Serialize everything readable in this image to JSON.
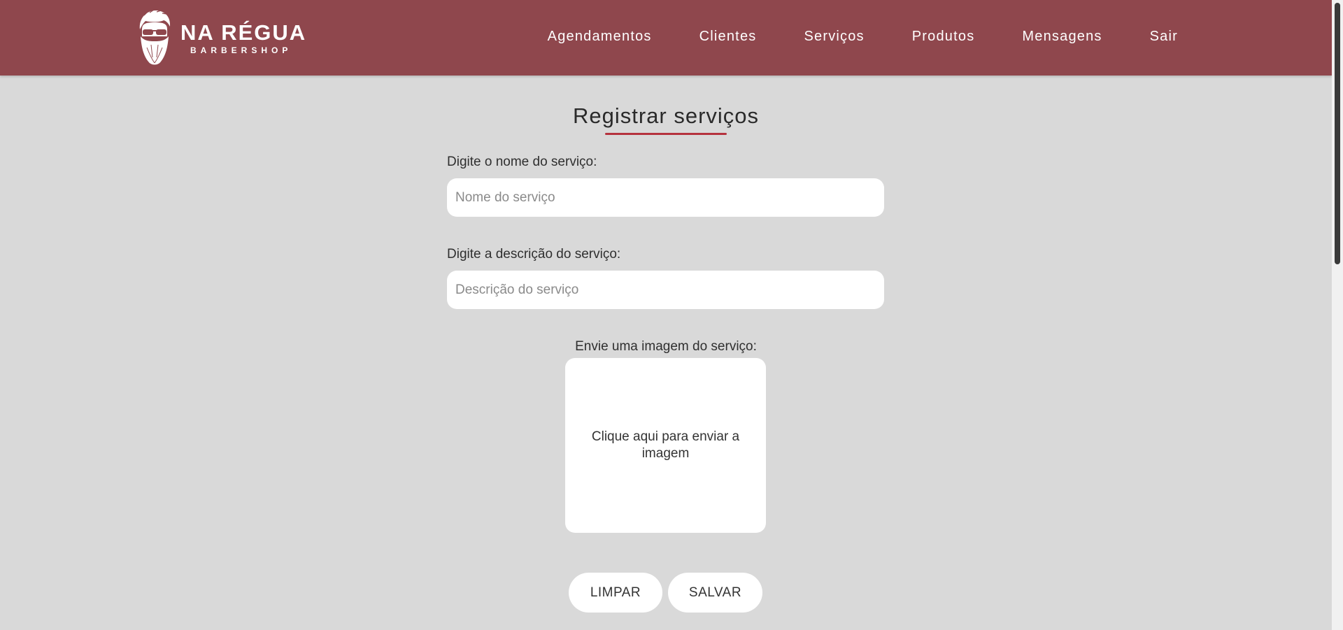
{
  "brand": {
    "title": "NA RÉGUA",
    "subtitle": "BARBERSHOP",
    "header_color": "#8f474d",
    "accent_color": "#b5323d"
  },
  "nav": {
    "items": [
      {
        "label": "Agendamentos"
      },
      {
        "label": "Clientes"
      },
      {
        "label": "Serviços"
      },
      {
        "label": "Produtos"
      },
      {
        "label": "Mensagens"
      },
      {
        "label": "Sair"
      }
    ]
  },
  "form": {
    "title": "Registrar serviços",
    "name_label": "Digite o nome do serviço:",
    "name_placeholder": "Nome do serviço",
    "name_value": "",
    "description_label": "Digite a descrição do serviço:",
    "description_placeholder": "Descrição do serviço",
    "description_value": "",
    "image_label": "Envie uma imagem do serviço:",
    "upload_text": "Clique aqui para enviar a imagem",
    "clear_label": "LIMPAR",
    "save_label": "SALVAR"
  }
}
